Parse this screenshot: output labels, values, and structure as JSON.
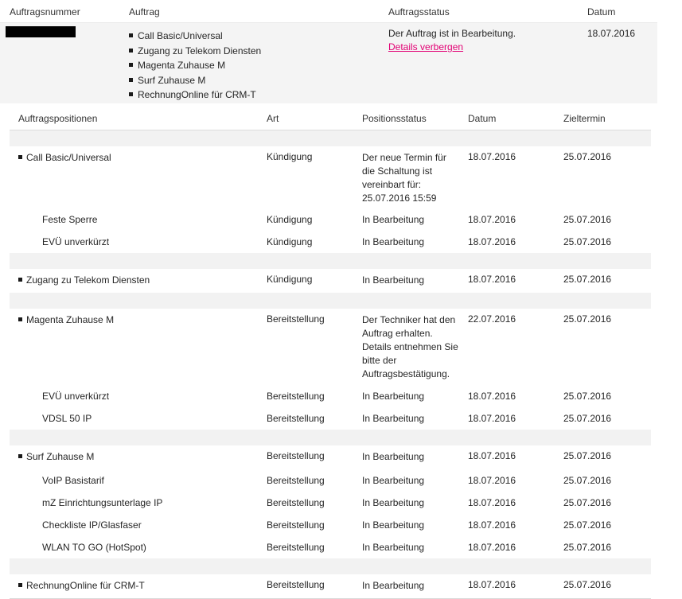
{
  "order_table": {
    "headers": {
      "number": "Auftragsnummer",
      "order": "Auftrag",
      "status": "Auftragsstatus",
      "date": "Datum"
    },
    "order": {
      "items": [
        "Call Basic/Universal",
        "Zugang zu Telekom Diensten",
        "Magenta Zuhause M",
        "Surf Zuhause M",
        "RechnungOnline für CRM-T"
      ],
      "status": "Der Auftrag ist in Bearbeitung.",
      "details_link": "Details verbergen",
      "date": "18.07.2016"
    }
  },
  "positions_table": {
    "headers": {
      "position": "Auftragspositionen",
      "type": "Art",
      "status": "Positionsstatus",
      "date": "Datum",
      "target": "Zieltermin"
    },
    "groups": [
      {
        "main": {
          "name": "Call Basic/Universal",
          "type": "Kündigung",
          "status": "Der neue Termin für die Schaltung ist vereinbart für: 25.07.2016 15:59",
          "date": "18.07.2016",
          "target": "25.07.2016"
        },
        "subs": [
          {
            "name": "Feste Sperre",
            "type": "Kündigung",
            "status": "In Bearbeitung",
            "date": "18.07.2016",
            "target": "25.07.2016"
          },
          {
            "name": "EVÜ unverkürzt",
            "type": "Kündigung",
            "status": "In Bearbeitung",
            "date": "18.07.2016",
            "target": "25.07.2016"
          }
        ]
      },
      {
        "main": {
          "name": "Zugang zu Telekom Diensten",
          "type": "Kündigung",
          "status": "In Bearbeitung",
          "date": "18.07.2016",
          "target": "25.07.2016"
        },
        "subs": []
      },
      {
        "main": {
          "name": "Magenta Zuhause M",
          "type": "Bereitstellung",
          "status": "Der Techniker hat den Auftrag erhalten. Details entnehmen Sie bitte der Auftragsbestätigung.",
          "date": "22.07.2016",
          "target": "25.07.2016"
        },
        "subs": [
          {
            "name": "EVÜ unverkürzt",
            "type": "Bereitstellung",
            "status": "In Bearbeitung",
            "date": "18.07.2016",
            "target": "25.07.2016"
          },
          {
            "name": "VDSL 50 IP",
            "type": "Bereitstellung",
            "status": "In Bearbeitung",
            "date": "18.07.2016",
            "target": "25.07.2016"
          }
        ]
      },
      {
        "main": {
          "name": "Surf Zuhause M",
          "type": "Bereitstellung",
          "status": "In Bearbeitung",
          "date": "18.07.2016",
          "target": "25.07.2016"
        },
        "subs": [
          {
            "name": "VoIP Basistarif",
            "type": "Bereitstellung",
            "status": "In Bearbeitung",
            "date": "18.07.2016",
            "target": "25.07.2016"
          },
          {
            "name": "mZ Einrichtungsunterlage IP",
            "type": "Bereitstellung",
            "status": "In Bearbeitung",
            "date": "18.07.2016",
            "target": "25.07.2016"
          },
          {
            "name": "Checkliste IP/Glasfaser",
            "type": "Bereitstellung",
            "status": "In Bearbeitung",
            "date": "18.07.2016",
            "target": "25.07.2016"
          },
          {
            "name": "WLAN TO GO (HotSpot)",
            "type": "Bereitstellung",
            "status": "In Bearbeitung",
            "date": "18.07.2016",
            "target": "25.07.2016"
          }
        ]
      },
      {
        "main": {
          "name": "RechnungOnline für CRM-T",
          "type": "Bereitstellung",
          "status": "In Bearbeitung",
          "date": "18.07.2016",
          "target": "25.07.2016"
        },
        "subs": []
      }
    ]
  }
}
